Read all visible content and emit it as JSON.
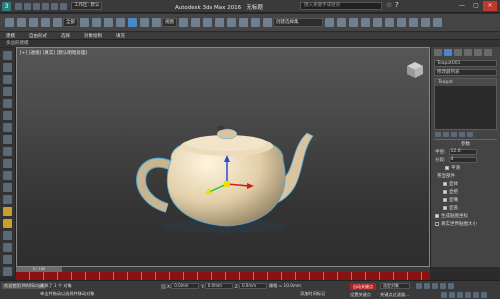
{
  "app": {
    "title": "Autodesk 3ds Max 2016",
    "doc": "无标题",
    "search_placeholder": "键入关键字或短语",
    "workspace_label": "工作区: 默认"
  },
  "toolbar": {
    "undo_dd": "全部",
    "view_dd": "视图",
    "selection_set": "创建选择集"
  },
  "ribbon": {
    "tabs": [
      "建模",
      "自由形式",
      "选择",
      "对象绘制",
      "填充"
    ],
    "sub": "多边形建模"
  },
  "viewport": {
    "label": "[+] [透视] [真实] [默认明暗处理]"
  },
  "command_panel": {
    "object_name": "Teapot001",
    "modifier_list": "修改器列表",
    "stack_items": [
      "Teapot"
    ],
    "params_title": "参数",
    "radius_label": "半径:",
    "radius_value": "12.0",
    "segments_label": "分段:",
    "segments_value": "4",
    "smooth_label": "平滑",
    "parts_title": "茶壶部件",
    "parts": [
      "壶体",
      "壶把",
      "壶嘴",
      "壶盖"
    ],
    "gen_uv": "生成贴图坐标",
    "real_world": "真实世界贴图大小"
  },
  "timeline": {
    "frame": "0 / 100",
    "ticks": [
      "0",
      "5",
      "10",
      "15",
      "20",
      "25",
      "30",
      "35",
      "40",
      "45",
      "50",
      "55",
      "60",
      "65",
      "70",
      "75",
      "80",
      "85",
      "90",
      "95",
      "100"
    ]
  },
  "status": {
    "selected": "选择了 1 个 对象",
    "prompt": "单击并拖动以选择并移动对象",
    "welcome": "欢迎使用 MAXScript",
    "x_label": "X:",
    "x_value": "0.0mm",
    "y_label": "Y:",
    "y_value": "0.0mm",
    "z_label": "Z:",
    "z_value": "0.0mm",
    "grid": "栅格 = 10.0mm",
    "add_time_tag": "添加时间标记",
    "auto_key": "自动关键点",
    "set_key": "设置关键点",
    "selected_dd": "选定对象",
    "key_filter": "关键点过滤器..."
  },
  "colors": {
    "accent": "#4a87c8",
    "teapot": "#e6d5b5",
    "trackbar": "#8a1111",
    "axis_x": "#d01c1c",
    "axis_y": "#1ecf1e",
    "axis_z": "#2a4ad8",
    "gizmo": "#e8e000"
  }
}
